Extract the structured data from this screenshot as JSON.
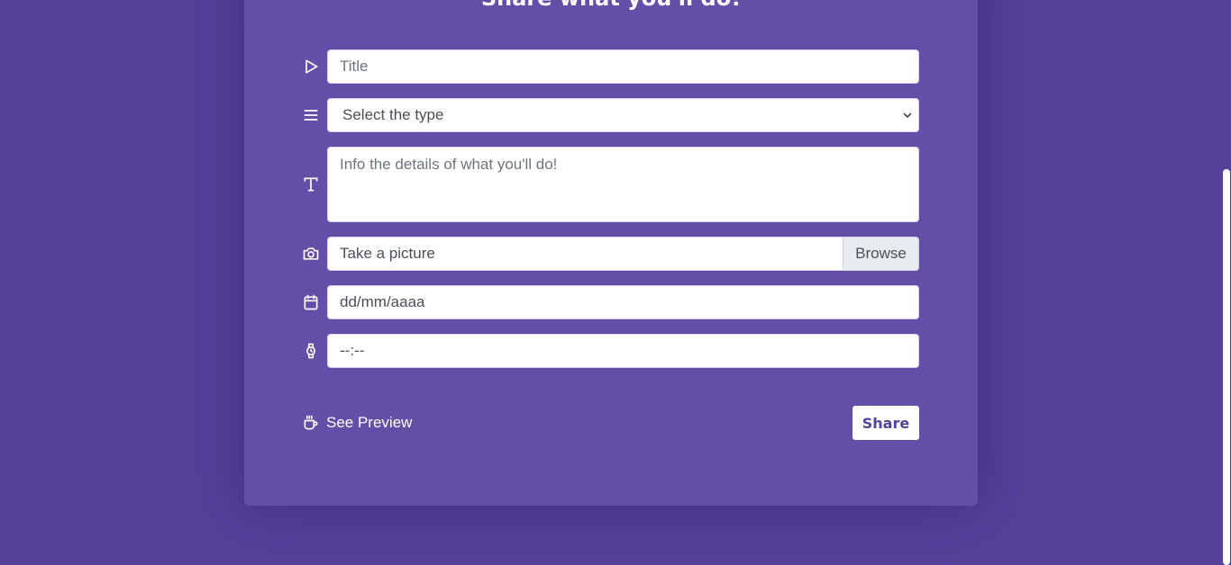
{
  "form": {
    "heading": "Share what you'll do!",
    "title_placeholder": "Title",
    "type_select_value": "Select the type",
    "details_placeholder": "Info the details of what you'll do!",
    "picture_label": "Take a picture",
    "browse_label": "Browse",
    "date_placeholder": "dd/mm/aaaa",
    "time_placeholder": "--:--",
    "see_preview_label": "See Preview",
    "share_label": "Share"
  },
  "icons": {
    "title": "play-icon",
    "type": "menu-lines-icon",
    "details": "text-type-icon",
    "picture": "camera-icon",
    "date": "calendar-icon",
    "time": "watch-icon",
    "preview": "coffee-cup-icon"
  },
  "colors": {
    "background": "#54419a",
    "card": "#634fa8",
    "accent_text": "#54419a"
  }
}
